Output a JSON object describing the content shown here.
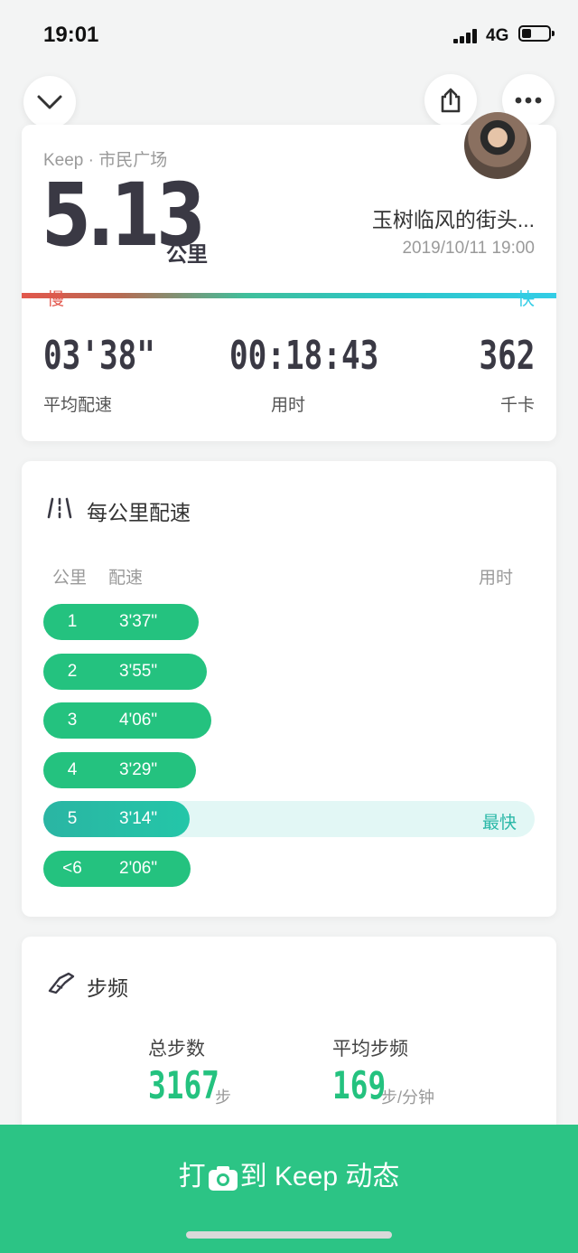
{
  "status_bar": {
    "time": "19:01",
    "network": "4G"
  },
  "activity": {
    "source": "Keep · 市民广场",
    "distance": "5.13",
    "distance_unit": "公里",
    "user_name": "玉树临风的街头...",
    "datetime": "2019/10/11 19:00",
    "slow_label": "慢",
    "fast_label": "快",
    "stats": [
      {
        "value": "03'38\"",
        "label": "平均配速"
      },
      {
        "value": "00:18:43",
        "label": "用时"
      },
      {
        "value": "362",
        "label": "千卡"
      }
    ]
  },
  "splits": {
    "title": "每公里配速",
    "col_km": "公里",
    "col_pace": "配速",
    "col_time": "用时",
    "fastest_tag": "最快",
    "rows": [
      {
        "km": "1",
        "pace": "3'37\"",
        "fastest": false
      },
      {
        "km": "2",
        "pace": "3'55\"",
        "fastest": false
      },
      {
        "km": "3",
        "pace": "4'06\"",
        "fastest": false
      },
      {
        "km": "4",
        "pace": "3'29\"",
        "fastest": false
      },
      {
        "km": "5",
        "pace": "3'14\"",
        "fastest": true
      },
      {
        "km": "<6",
        "pace": "2'06\"",
        "fastest": false
      }
    ]
  },
  "cadence": {
    "title": "步频",
    "total_steps_label": "总步数",
    "total_steps": "3167",
    "total_steps_unit": "步",
    "avg_cadence_label": "平均步频",
    "avg_cadence": "169",
    "avg_cadence_unit": "步/分钟"
  },
  "bottom_action": {
    "prefix": "打",
    "suffix": "到 Keep 动态"
  },
  "colors": {
    "accent_green": "#2cc485",
    "slow_red": "#e2574c",
    "fast_cyan": "#33cde6"
  }
}
